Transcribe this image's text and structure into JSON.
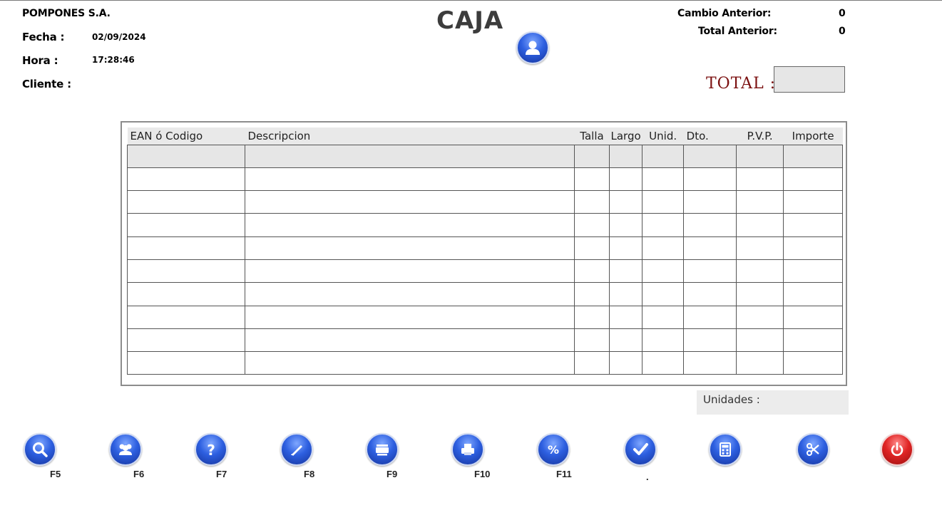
{
  "header": {
    "company": "POMPONES S.A.",
    "fecha_label": "Fecha :",
    "fecha_value": "02/09/2024",
    "hora_label": "Hora :",
    "hora_value": "17:28:46",
    "cliente_label": "Cliente :",
    "title": "CAJA",
    "cambio_label": "Cambio Anterior:",
    "cambio_value": "0",
    "total_anterior_label": "Total Anterior:",
    "total_anterior_value": "0",
    "total_label": "TOTAL :",
    "total_value": ""
  },
  "table": {
    "columns": [
      "EAN ó Codigo",
      "Descripcion",
      "Talla",
      "Largo",
      "Unid.",
      "Dto.",
      "P.V.P.",
      "Importe"
    ],
    "rows": [
      [
        "",
        "",
        "",
        "",
        "",
        "",
        "",
        ""
      ],
      [
        "",
        "",
        "",
        "",
        "",
        "",
        "",
        ""
      ],
      [
        "",
        "",
        "",
        "",
        "",
        "",
        "",
        ""
      ],
      [
        "",
        "",
        "",
        "",
        "",
        "",
        "",
        ""
      ],
      [
        "",
        "",
        "",
        "",
        "",
        "",
        "",
        ""
      ],
      [
        "",
        "",
        "",
        "",
        "",
        "",
        "",
        ""
      ],
      [
        "",
        "",
        "",
        "",
        "",
        "",
        "",
        ""
      ],
      [
        "",
        "",
        "",
        "",
        "",
        "",
        "",
        ""
      ],
      [
        "",
        "",
        "",
        "",
        "",
        "",
        "",
        ""
      ],
      [
        "",
        "",
        "",
        "",
        "",
        "",
        "",
        ""
      ]
    ]
  },
  "footer": {
    "unidades_label": "Unidades :",
    "unidades_value": ""
  },
  "toolbar": {
    "buttons": [
      {
        "icon": "search-icon",
        "key": "F5"
      },
      {
        "icon": "users-icon",
        "key": "F6"
      },
      {
        "icon": "help-icon",
        "key": "F7"
      },
      {
        "icon": "pen-icon",
        "key": "F8"
      },
      {
        "icon": "printer-stack-icon",
        "key": "F9"
      },
      {
        "icon": "printer-icon",
        "key": "F10"
      },
      {
        "icon": "percent-icon",
        "key": "F11"
      },
      {
        "icon": "check-icon",
        "key": "."
      },
      {
        "icon": "calculator-icon",
        "key": ""
      },
      {
        "icon": "scissors-icon",
        "key": ""
      },
      {
        "icon": "power-icon",
        "key": ""
      }
    ]
  },
  "colors": {
    "button_blue": "#2d5fe0",
    "button_red": "#e02424",
    "total_label": "#7b1010"
  }
}
